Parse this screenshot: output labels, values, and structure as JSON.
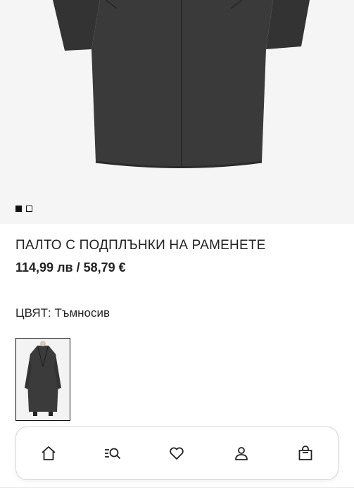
{
  "gallery": {
    "image_alt": "coat-back-view",
    "slide_count": 2,
    "active_slide": 1
  },
  "product": {
    "name": "ПАЛТО С ПОДПЛЪНКИ НА РАМЕНЕТЕ",
    "price": "114,99 лв / 58,79 €"
  },
  "color": {
    "label": "ЦВЯТ:",
    "value": "Тъмносив"
  },
  "nav": {
    "items": [
      {
        "icon": "home-icon"
      },
      {
        "icon": "search-menu-icon"
      },
      {
        "icon": "heart-icon"
      },
      {
        "icon": "user-icon"
      },
      {
        "icon": "shopping-bag-icon"
      }
    ]
  }
}
